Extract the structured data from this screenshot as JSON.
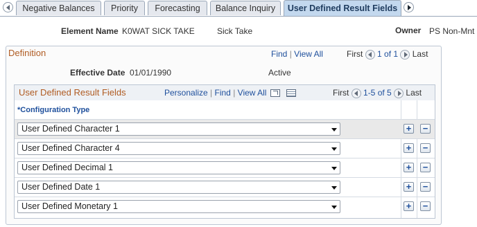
{
  "tabs": [
    {
      "label": "Negative Balances"
    },
    {
      "label": "Priority"
    },
    {
      "label": "Forecasting"
    },
    {
      "label": "Balance Inquiry"
    },
    {
      "label": "User Defined Result Fields"
    }
  ],
  "header": {
    "element_name_label": "Element Name",
    "element_name_value": "K0WAT SICK TAKE",
    "element_desc": "Sick Take",
    "owner_label": "Owner",
    "owner_value": "PS Non-Mnt"
  },
  "definition": {
    "title": "Definition",
    "find": "Find",
    "sep": "|",
    "view_all": "View All",
    "first": "First",
    "page_info": "1 of 1",
    "last": "Last",
    "effective_date_label": "Effective Date",
    "effective_date_value": "01/01/1990",
    "status": "Active"
  },
  "grid": {
    "title": "User Defined Result Fields",
    "personalize": "Personalize",
    "sep": "|",
    "find": "Find",
    "view_all": "View All",
    "first": "First",
    "page_info": "1-5 of 5",
    "last": "Last",
    "column_header": "*Configuration Type",
    "rows": [
      {
        "value": "User Defined Character 1"
      },
      {
        "value": "User Defined Character 4"
      },
      {
        "value": "User Defined Decimal 1"
      },
      {
        "value": "User Defined Date 1"
      },
      {
        "value": "User Defined Monetary 1"
      }
    ]
  }
}
